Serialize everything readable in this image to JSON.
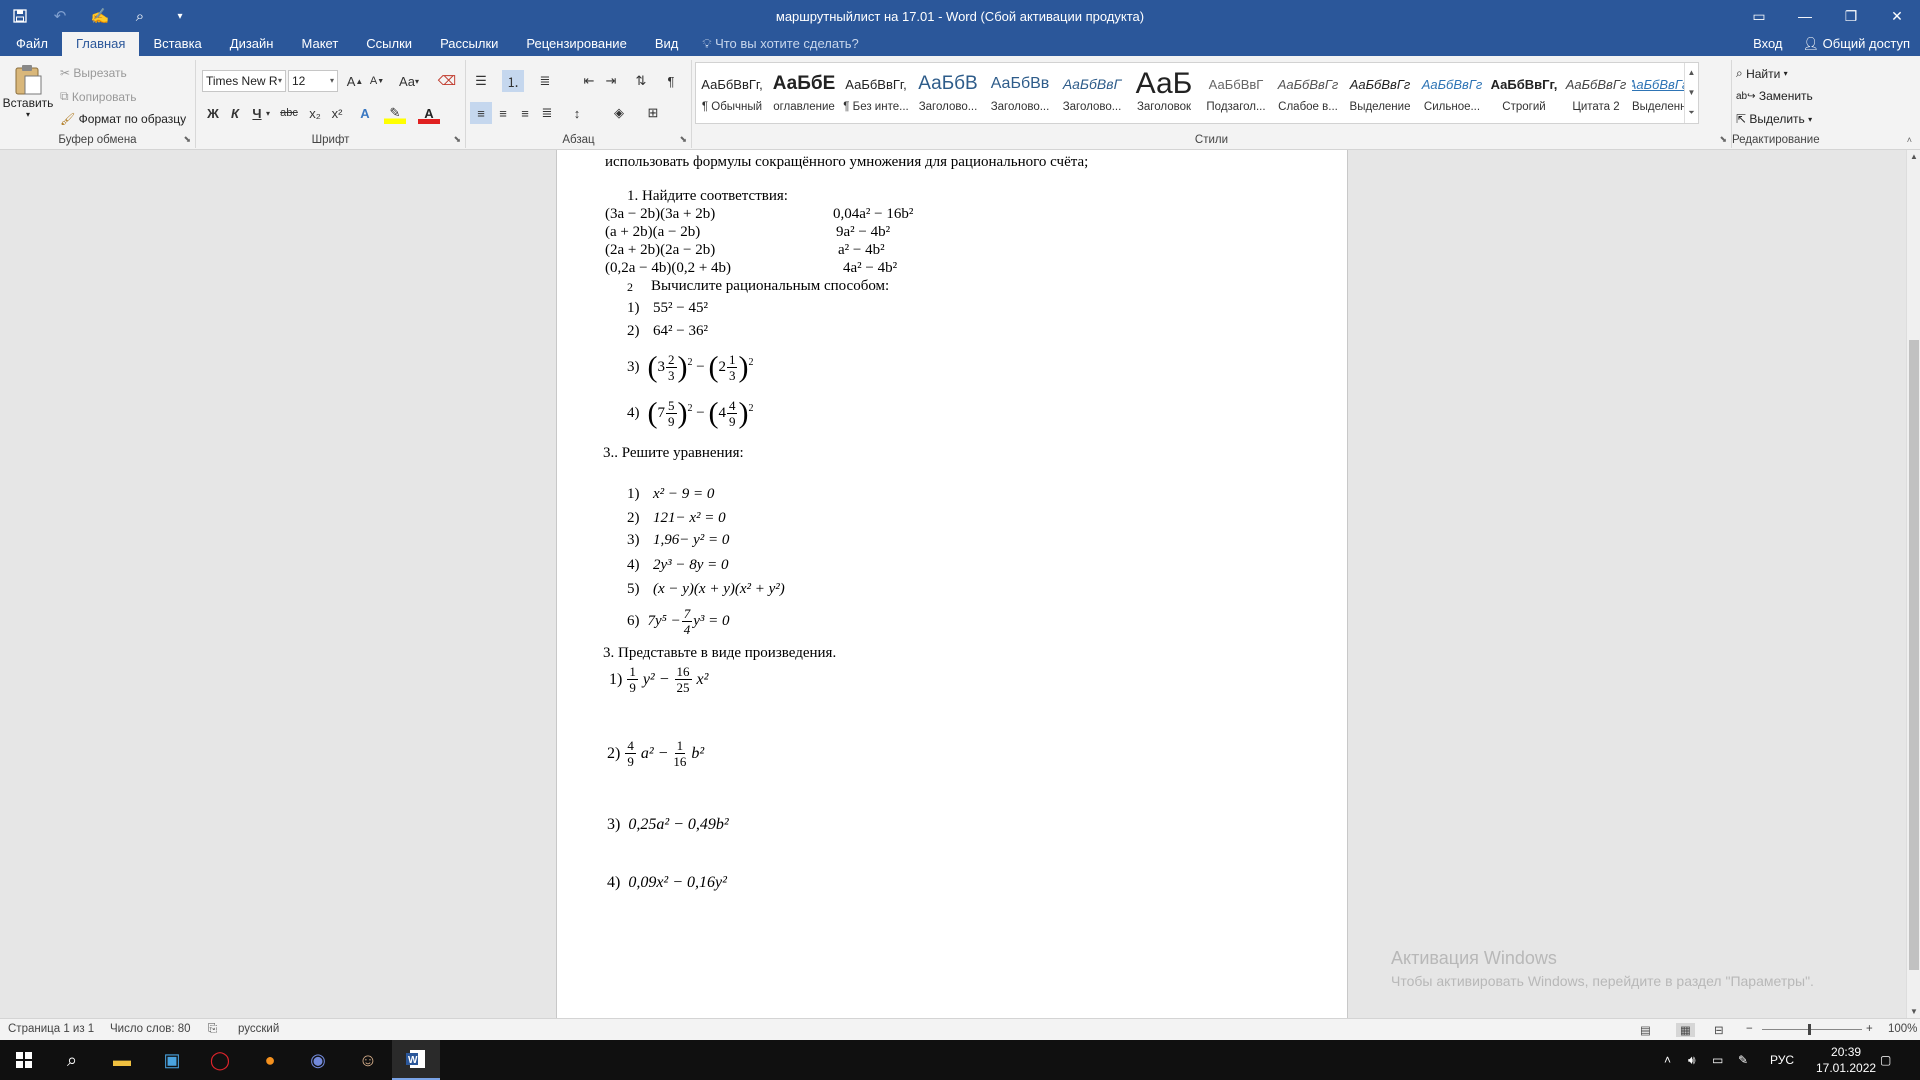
{
  "window": {
    "title": "маршрутныйлист на 17.01 - Word (Сбой активации продукта)",
    "quick_access": [
      "save-icon",
      "undo-icon",
      "touch-mode-icon",
      "print-preview-icon",
      "customize-icon"
    ],
    "controls": {
      "ribbon_options": "▭",
      "minimize": "—",
      "restore": "❐",
      "close": "✕"
    }
  },
  "tabs": {
    "file": "Файл",
    "home": "Главная",
    "insert": "Вставка",
    "design": "Дизайн",
    "layout": "Макет",
    "references": "Ссылки",
    "mailings": "Рассылки",
    "review": "Рецензирование",
    "view": "Вид",
    "tell_me": "Что вы хотите сделать?",
    "sign_in": "Вход",
    "share": "Общий доступ"
  },
  "ribbon": {
    "clipboard": {
      "paste": "Вставить",
      "cut": "Вырезать",
      "copy": "Копировать",
      "format_painter": "Формат по образцу",
      "label": "Буфер обмена"
    },
    "font": {
      "font_name": "Times New R",
      "font_size": "12",
      "case": "Aa",
      "bold": "Ж",
      "italic": "К",
      "underline": "Ч",
      "strike": "abc",
      "subscript": "x₂",
      "superscript": "x²",
      "label": "Шрифт"
    },
    "paragraph": {
      "label": "Абзац"
    },
    "styles": {
      "label": "Стили",
      "items": [
        {
          "preview": "АаБбВвГг,",
          "name": "¶ Обычный"
        },
        {
          "preview": "АаБбЕ",
          "name": "оглавление"
        },
        {
          "preview": "АаБбВвГг,",
          "name": "¶ Без инте..."
        },
        {
          "preview": "АаБбВ",
          "name": "Заголово..."
        },
        {
          "preview": "АаБбВв",
          "name": "Заголово..."
        },
        {
          "preview": "АаБбВвГ",
          "name": "Заголово..."
        },
        {
          "preview": "АаБ",
          "name": "Заголовок"
        },
        {
          "preview": "АаБбВвГ",
          "name": "Подзагол..."
        },
        {
          "preview": "АаБбВвГг",
          "name": "Слабое в..."
        },
        {
          "preview": "АаБбВвГг",
          "name": "Выделение"
        },
        {
          "preview": "АаБбВвГг",
          "name": "Сильное..."
        },
        {
          "preview": "АаБбВвГг,",
          "name": "Строгий"
        },
        {
          "preview": "АаБбВвГг",
          "name": "Цитата 2"
        },
        {
          "preview": "АаБбВвГг",
          "name": "Выделенн..."
        }
      ]
    },
    "editing": {
      "label": "Редактирование",
      "find": "Найти",
      "replace": "Заменить",
      "select": "Выделить"
    }
  },
  "document": {
    "intro": "использовать формулы сокращённого умножения для рационального счёта;",
    "task1_title": "1.   Найдите соответствия:",
    "task1_left": [
      "(3a − 2b)(3a + 2b)",
      "(a + 2b)(a − 2b)",
      "(2a + 2b)(2a − 2b)",
      "(0,2a − 4b)(0,2 + 4b)"
    ],
    "task1_right": [
      "0,04a² − 16b²",
      "9a² − 4b²",
      "a² − 4b²",
      "4a² − 4b²"
    ],
    "task2_num": "2",
    "task2_title": "Вычислите рациональным способом:",
    "task2_items": {
      "i1_num": "1)",
      "i1": "55² − 45²",
      "i2_num": "2)",
      "i2": "64² − 36²",
      "i3_num": "3)",
      "i3_w1": "3",
      "i3_n1": "2",
      "i3_d1": "3",
      "i3_w2": "2",
      "i3_n2": "1",
      "i3_d2": "3",
      "i4_num": "4)",
      "i4_w1": "7",
      "i4_n1": "5",
      "i4_d1": "9",
      "i4_w2": "4",
      "i4_n2": "4",
      "i4_d2": "9"
    },
    "task3_title": "3..    Решите уравнения:",
    "task3_items": [
      {
        "num": "1)",
        "expr": "x² − 9 = 0"
      },
      {
        "num": "2)",
        "expr": "121− x² = 0"
      },
      {
        "num": "3)",
        "expr": "1,96− y² = 0"
      },
      {
        "num": "4)",
        "expr": "2y³ − 8y = 0"
      },
      {
        "num": "5)",
        "expr": "(x − y)(x + y)(x² + y²)"
      }
    ],
    "task3_item6": {
      "num": "6)",
      "a": "7y⁵ −",
      "n": "7",
      "d": "4",
      "b": "y³ = 0"
    },
    "task4_title": "3. Представьте в виде произведения.",
    "task4": {
      "i1_num": "1)",
      "i1_n1": "1",
      "i1_d1": "9",
      "i1_mid": "y² −",
      "i1_n2": "16",
      "i1_d2": "25",
      "i1_end": "x²",
      "i2_num": "2)",
      "i2_n1": "4",
      "i2_d1": "9",
      "i2_mid": "a² −",
      "i2_n2": "1",
      "i2_d2": "16",
      "i2_end": "b²",
      "i3_num": "3)",
      "i3": "0,25a² − 0,49b²",
      "i4_num": "4)",
      "i4": "0,09x² − 0,16y²"
    }
  },
  "watermark": {
    "line1": "Активация Windows",
    "line2": "Чтобы активировать Windows, перейдите в раздел \"Параметры\"."
  },
  "statusbar": {
    "page": "Страница 1 из 1",
    "words": "Число слов: 80",
    "language": "русский",
    "zoom": "100%"
  },
  "taskbar": {
    "lang": "РУС",
    "time": "20:39",
    "date": "17.01.2022"
  }
}
